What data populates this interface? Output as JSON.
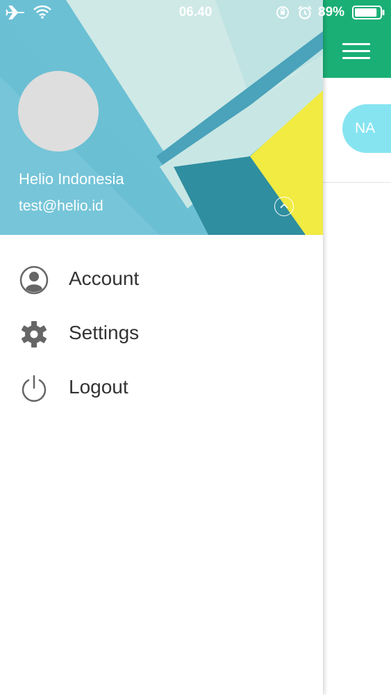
{
  "status_bar": {
    "time": "06.40",
    "battery": "89%",
    "battery_level": 0.89
  },
  "drawer": {
    "profile": {
      "name": "Helio Indonesia",
      "email": "test@helio.id"
    },
    "menu": [
      {
        "label": "Account",
        "icon": "account-circle-icon"
      },
      {
        "label": "Settings",
        "icon": "gear-icon"
      },
      {
        "label": "Logout",
        "icon": "power-icon"
      }
    ]
  },
  "app": {
    "avatar_initials": "NA",
    "toolbar_color": "#1aaf75",
    "avatar_color": "#86e4f1"
  }
}
